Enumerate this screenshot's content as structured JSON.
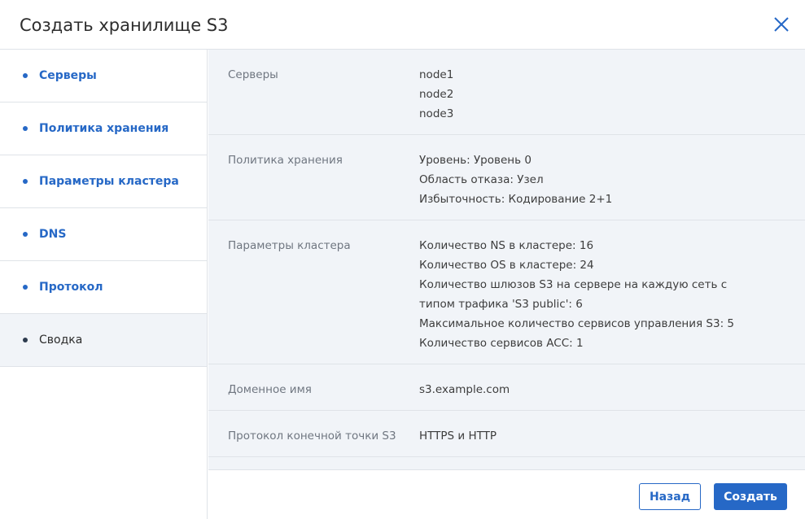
{
  "dialog": {
    "title": "Создать хранилище S3"
  },
  "sidebar": {
    "items": [
      {
        "label": "Серверы"
      },
      {
        "label": "Политика хранения"
      },
      {
        "label": "Параметры кластера"
      },
      {
        "label": "DNS"
      },
      {
        "label": "Протокол"
      },
      {
        "label": "Сводка"
      }
    ],
    "active_index": 5
  },
  "summary": {
    "servers": {
      "label": "Серверы",
      "values": [
        "node1",
        "node2",
        "node3"
      ]
    },
    "storage_policy": {
      "label": "Политика хранения",
      "values": [
        "Уровень: Уровень 0",
        "Область отказа: Узел",
        "Избыточность: Кодирование 2+1"
      ]
    },
    "cluster_params": {
      "label": "Параметры кластера",
      "values": [
        "Количество NS в кластере: 16",
        "Количество OS в кластере: 24",
        "Количество шлюзов S3 на сервере на каждую сеть с типом трафика 'S3 public': 6",
        "Максимальное количество сервисов управления S3: 5",
        "Количество сервисов ACC: 1"
      ]
    },
    "domain": {
      "label": "Доменное имя",
      "value": "s3.example.com"
    },
    "protocol": {
      "label": "Протокол конечной точки S3",
      "value": "HTTPS и HTTP"
    }
  },
  "footer": {
    "back_label": "Назад",
    "create_label": "Создать"
  },
  "colors": {
    "accent": "#2668c6",
    "panel_bg": "#f1f4f8",
    "border": "#dfe3e8"
  },
  "icons": {
    "close": "close-icon"
  }
}
